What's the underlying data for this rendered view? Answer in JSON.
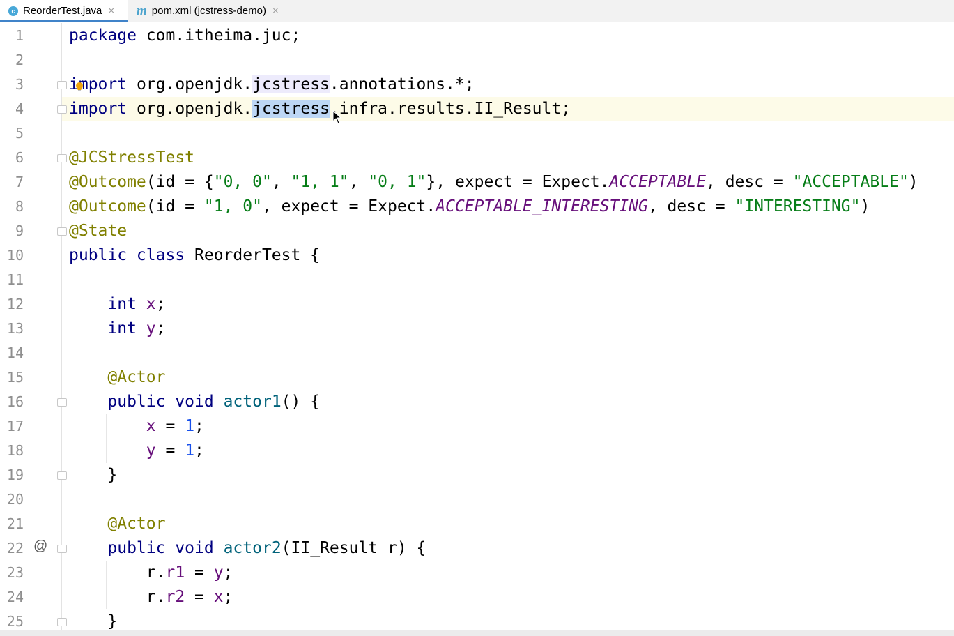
{
  "tabs": [
    {
      "name": "ReorderTest.java",
      "icon": "c",
      "active": true
    },
    {
      "name": "pom.xml (jcstress-demo)",
      "icon": "m",
      "active": false
    }
  ],
  "close_glyph": "×",
  "gutter": {
    "numbers": [
      "1",
      "2",
      "3",
      "4",
      "5",
      "6",
      "7",
      "8",
      "9",
      "10",
      "11",
      "12",
      "13",
      "14",
      "15",
      "16",
      "17",
      "18",
      "19",
      "20",
      "21",
      "22",
      "23",
      "24",
      "25"
    ],
    "override_marker": "@"
  },
  "code": {
    "l1": {
      "kw": "package",
      "rest": " com.itheima.juc;"
    },
    "l3": {
      "kw": "import",
      "a": " org.openjdk.",
      "b": "jcstress",
      "c": ".annotations.*;"
    },
    "l4": {
      "kw": "import",
      "a": " org.openjdk.",
      "b": "jcstress",
      "c": ".infra.results.II_Result;"
    },
    "l6": {
      "ann": "@JCStressTest"
    },
    "l7": {
      "ann": "@Outcome",
      "p1": "(id = {",
      "s1": "\"0, 0\"",
      "p2": ", ",
      "s2": "\"1, 1\"",
      "p3": ", ",
      "s3": "\"0, 1\"",
      "p4": "}, expect = Expect.",
      "const": "ACCEPTABLE",
      "p5": ", desc = ",
      "s4": "\"ACCEPTABLE\"",
      "p6": ")"
    },
    "l8": {
      "ann": "@Outcome",
      "p1": "(id = ",
      "s1": "\"1, 0\"",
      "p2": ", expect = Expect.",
      "const": "ACCEPTABLE_INTERESTING",
      "p3": ", desc = ",
      "s2": "\"INTERESTING\"",
      "p4": ")"
    },
    "l9": {
      "ann": "@State"
    },
    "l10": {
      "kw": "public class",
      "rest": " ReorderTest {"
    },
    "l12": {
      "kw": "int",
      "field": "x",
      "end": ";"
    },
    "l13": {
      "kw": "int",
      "field": "y",
      "end": ";"
    },
    "l15": {
      "ann": "@Actor"
    },
    "l16": {
      "kw": "public void",
      "fn": "actor1",
      "rest": "() {"
    },
    "l17": {
      "field": "x",
      "op": " = ",
      "num": "1",
      "end": ";"
    },
    "l18": {
      "field": "y",
      "op": " = ",
      "num": "1",
      "end": ";"
    },
    "l19": {
      "text": "}"
    },
    "l21": {
      "ann": "@Actor"
    },
    "l22": {
      "kw": "public void",
      "fn": "actor2",
      "rest": "(II_Result r) {"
    },
    "l23": {
      "obj": "r.",
      "field": "r1",
      "op": " = ",
      "val": "y",
      "end": ";"
    },
    "l24": {
      "obj": "r.",
      "field": "r2",
      "op": " = ",
      "val": "x",
      "end": ";"
    },
    "l25": {
      "text": "}"
    }
  }
}
